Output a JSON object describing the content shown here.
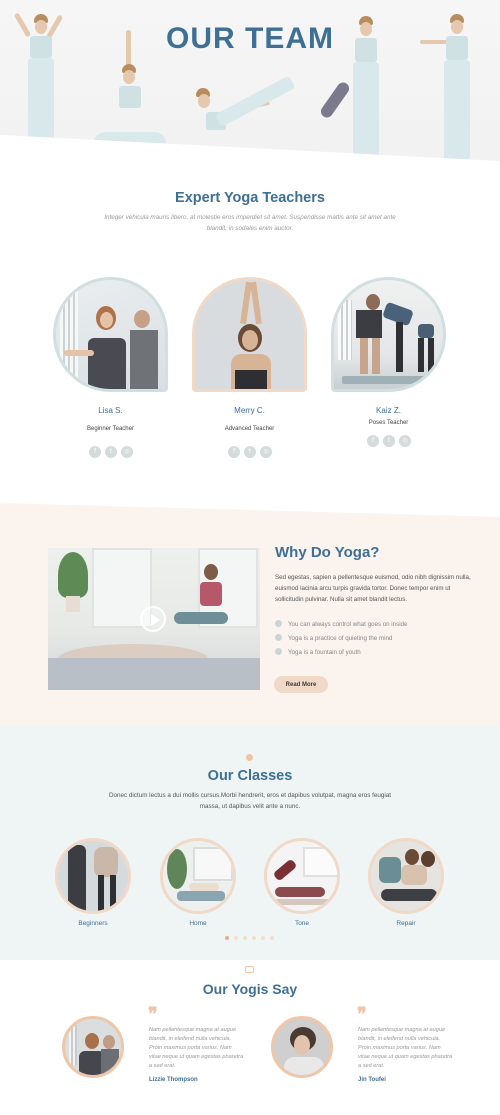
{
  "hero": {
    "title": "OUR TEAM"
  },
  "experts": {
    "title": "Expert Yoga Teachers",
    "subtitle": "Integer vehicula mauris libero, at molestie eros imperdiet sit amet. Suspendisse mattis ante sit amet ante blandit, in sodales enim auctor."
  },
  "teachers": [
    {
      "name": "Lisa S.",
      "role": "Beginner Teacher"
    },
    {
      "name": "Merry C.",
      "role": "Advanced Teacher"
    },
    {
      "name": "Kaiz Z.",
      "role": "Poses Teacher"
    }
  ],
  "social_icons": [
    "facebook-icon",
    "twitter-icon",
    "instagram-icon"
  ],
  "why": {
    "title": "Why Do Yoga?",
    "text": "Sed egestas, sapien a pellentesque euismod, odio nibh dignissim nulla, euismod lacinia arcu turpis gravida tortor. Donec tempor enim ut sollicitudin pulvinar. Nulla sit amet blandit lectus.",
    "bullets": [
      "You can always control what goes on inside",
      "Yoga is a practice of quieting the mind",
      "Yoga is a fountain of youth"
    ],
    "button": "Read More"
  },
  "classes": {
    "title": "Our Classes",
    "subtitle": "Donec dictum lectus a dui mollis cursus.Morbi hendrerit, eros et dapibus volutpat, magna eros feugiat massa, ut dapibus velit ante a nunc.",
    "items": [
      "Beginners",
      "Home",
      "Tone",
      "Repair"
    ]
  },
  "yogis": {
    "title": "Our Yogis Say",
    "testimonials": [
      {
        "text": "Nam pellentesque magna at augue blandit, in eleifend nulla vehicula. Proin maximus porta varius. Nam vitae neque ut quam egestas pharetra a sed erat.",
        "name": "Lizzie Thompson"
      },
      {
        "text": "Nam pellentesque magna at augue blandit, in eleifend nulla vehicula. Proin maximus porta varius. Nam vitae neque ut quam egestas pharetra a sed erat.",
        "name": "Jin Toufei"
      }
    ]
  },
  "colors": {
    "accent": "#3e6f95",
    "peach": "#f1d9c8",
    "mint": "#eff4f5"
  }
}
